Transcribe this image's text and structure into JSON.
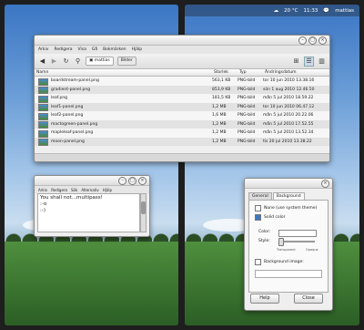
{
  "top_panel": {
    "temperature": "20 °C",
    "time": "11:33",
    "user": "mattias"
  },
  "file_manager": {
    "menu": [
      "Arkiv",
      "Redigera",
      "Visa",
      "Gå",
      "Bokmärken",
      "Hjälp"
    ],
    "breadcrumbs": [
      "mattias",
      "Bilder"
    ],
    "columns": [
      "Namn",
      "Storlek",
      "Typ",
      "Ändringsdatum"
    ],
    "rows": [
      {
        "name": "boardstream-panel.png",
        "size": "563,1 KB",
        "type": "PNG-bild",
        "date": "tor 10 jun 2010 13.38.16"
      },
      {
        "name": "gradient-panel.png",
        "size": "853,9 KB",
        "type": "PNG-bild",
        "date": "sön 1 aug 2010 12.46.50"
      },
      {
        "name": "leaf.png",
        "size": "181,5 KB",
        "type": "PNG-bild",
        "date": "mån 5 jul 2010 18.59.22"
      },
      {
        "name": "leaf1-panel.png",
        "size": "1,2 MB",
        "type": "PNG-bild",
        "date": "tor 10 jun 2010 06.47.12"
      },
      {
        "name": "leaf2-panel.png",
        "size": "1,6 MB",
        "type": "PNG-bild",
        "date": "mån 5 jul 2010 20.22.06"
      },
      {
        "name": "mactogreen-panel.png",
        "size": "1,2 MB",
        "type": "PNG-bild",
        "date": "mån 5 jul 2010 17.52.55"
      },
      {
        "name": "mapleleaf-panel.png",
        "size": "1,2 MB",
        "type": "PNG-bild",
        "date": "mån 5 jul 2010 13.52.34"
      },
      {
        "name": "moon-panel.png",
        "size": "1,2 MB",
        "type": "PNG-bild",
        "date": "tis 20 jul 2010 13.38.22"
      }
    ]
  },
  "text_editor": {
    "menu": [
      "Arkiv",
      "Redigera",
      "Sök",
      "Alternativ",
      "Hjälp"
    ],
    "lines": [
      "You shall not...multipass!",
      ":-o",
      ":-)"
    ]
  },
  "preferences": {
    "tabs": [
      "General",
      "Background"
    ],
    "opt_none": "None (use system theme)",
    "opt_solid": "Solid color",
    "color_label": "Color:",
    "style_label": "Style:",
    "transparent": "Transparent",
    "opaque": "Opaque",
    "bg_image": "Background image:",
    "help": "Help",
    "close": "Close"
  }
}
